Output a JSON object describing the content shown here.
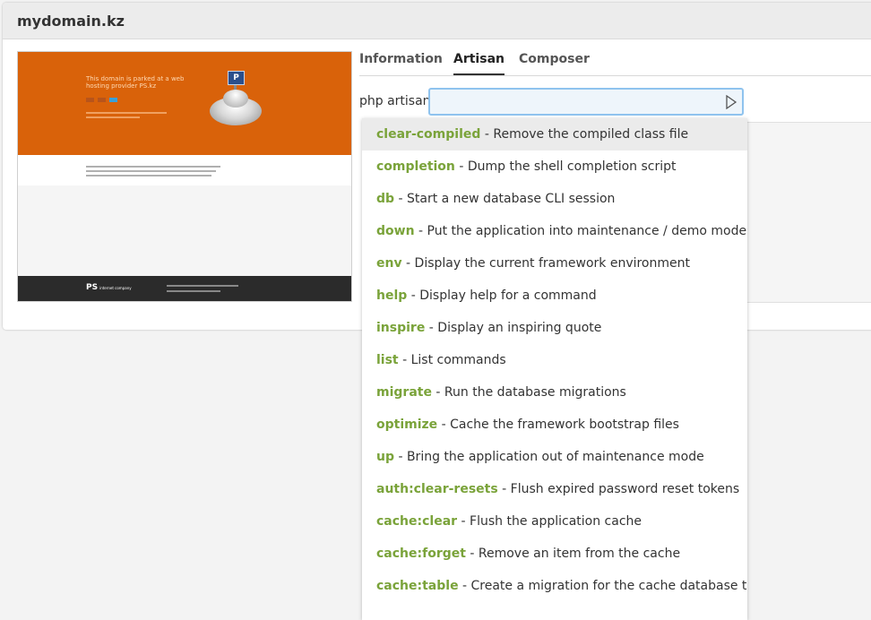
{
  "card": {
    "title": "mydomain.kz"
  },
  "preview": {
    "headline": "This domain is parked at a web hosting provider PS.kz",
    "sign_letter": "P",
    "footer_logo": "PS",
    "footer_logo_sub": "internet company"
  },
  "tabs": [
    {
      "label": "Information",
      "active": false
    },
    {
      "label": "Artisan",
      "active": true
    },
    {
      "label": "Composer",
      "active": false
    }
  ],
  "command": {
    "label": "php artisan",
    "value": "",
    "placeholder": "",
    "run_icon": "play-icon"
  },
  "colors": {
    "command_name": "#7aa33a",
    "highlight": "#ebebeb",
    "input_border": "#8fc3ee"
  },
  "suggestions": [
    {
      "name": "clear-compiled",
      "desc": "- Remove the compiled class file",
      "highlighted": true
    },
    {
      "name": "completion",
      "desc": "- Dump the shell completion script",
      "highlighted": false
    },
    {
      "name": "db",
      "desc": "- Start a new database CLI session",
      "highlighted": false
    },
    {
      "name": "down",
      "desc": "- Put the application into maintenance / demo mode",
      "highlighted": false
    },
    {
      "name": "env",
      "desc": "- Display the current framework environment",
      "highlighted": false
    },
    {
      "name": "help",
      "desc": "- Display help for a command",
      "highlighted": false
    },
    {
      "name": "inspire",
      "desc": "- Display an inspiring quote",
      "highlighted": false
    },
    {
      "name": "list",
      "desc": "- List commands",
      "highlighted": false
    },
    {
      "name": "migrate",
      "desc": "- Run the database migrations",
      "highlighted": false
    },
    {
      "name": "optimize",
      "desc": "- Cache the framework bootstrap files",
      "highlighted": false
    },
    {
      "name": "up",
      "desc": "- Bring the application out of maintenance mode",
      "highlighted": false
    },
    {
      "name": "auth:clear-resets",
      "desc": "- Flush expired password reset tokens",
      "highlighted": false
    },
    {
      "name": "cache:clear",
      "desc": "- Flush the application cache",
      "highlighted": false
    },
    {
      "name": "cache:forget",
      "desc": "- Remove an item from the cache",
      "highlighted": false
    },
    {
      "name": "cache:table",
      "desc": "- Create a migration for the cache database table",
      "highlighted": false
    }
  ]
}
